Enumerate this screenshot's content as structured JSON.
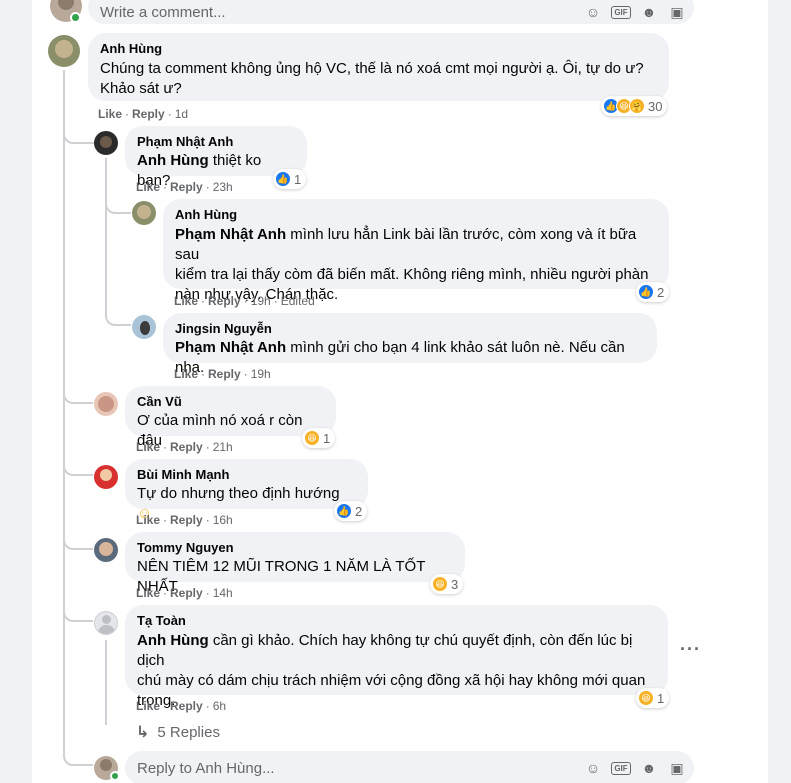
{
  "top_composer": {
    "placeholder": "Write a comment..."
  },
  "bottom_composer": {
    "placeholder": "Reply to Anh Hùng..."
  },
  "actions": {
    "like": "Like",
    "reply": "Reply",
    "dot": "·"
  },
  "comments": [
    {
      "author": "Anh Hùng",
      "text_line1": "Chúng ta comment không ủng hộ VC, thế là nó xoá cmt mọi người ạ. Ôi, tự do ư?",
      "text_line2": "Khảo sát ư?",
      "time": "1d",
      "reaction_count": "30"
    },
    {
      "author": "Phạm Nhật Anh",
      "tag": "Anh Hùng",
      "text": "thiệt ko bạn?",
      "time": "23h",
      "reaction_count": "1"
    },
    {
      "author": "Anh Hùng",
      "tag": "Phạm Nhật Anh",
      "text_line1": "mình lưu hẳn Link bài lần trước, còm xong và ít bữa sau",
      "text_line2": "kiểm tra lại thấy còm đã biến mất. Không riêng mình, nhiều người phàn",
      "text_line3": "nàn như vậy. Chán thặc.",
      "time": "19h",
      "edited": "Edited",
      "reaction_count": "2"
    },
    {
      "author": "Jingsin Nguyễn",
      "tag": "Phạm Nhật Anh",
      "text": "mình gửi cho bạn 4 link khảo sát luôn nè. Nếu cần nha.",
      "time": "19h"
    },
    {
      "author": "Cần Vũ",
      "text": "Ơ của mình nó xoá r còn đâu",
      "time": "21h",
      "reaction_count": "1"
    },
    {
      "author": "Bùi Minh Mạnh",
      "text": "Tự do nhưng theo định hướng",
      "time": "16h",
      "reaction_count": "2"
    },
    {
      "author": "Tommy Nguyen",
      "text": "NÊN TIÊM 12 MŨI TRONG 1 NĂM LÀ TỐT NHẤT",
      "time": "14h",
      "reaction_count": "3"
    },
    {
      "author": "Tạ Toàn",
      "tag": "Anh Hùng",
      "text_line1": "cần gì khảo. Chích hay không tự chú quyết định, còn đến lúc bị dịch",
      "text_line2": "chú mày có dám chịu trách nhiệm với cộng đồng xã hội hay không mới quan",
      "text_line3": "trọng.",
      "time": "6h",
      "reaction_count": "1"
    }
  ],
  "view_replies": "5 Replies",
  "more_label": "···",
  "colors": {
    "like_blue": "#1877f2",
    "haha_yellow": "#f7b125",
    "online_green": "#31a24c",
    "bubble_gray": "#f0f2f5",
    "meta_gray": "#65676b"
  },
  "icons": [
    "smile-icon",
    "gif-icon",
    "sticker-icon",
    "sticker-pack-icon",
    "like-icon",
    "haha-icon",
    "care-icon",
    "reply-arrow-icon",
    "more-icon"
  ]
}
